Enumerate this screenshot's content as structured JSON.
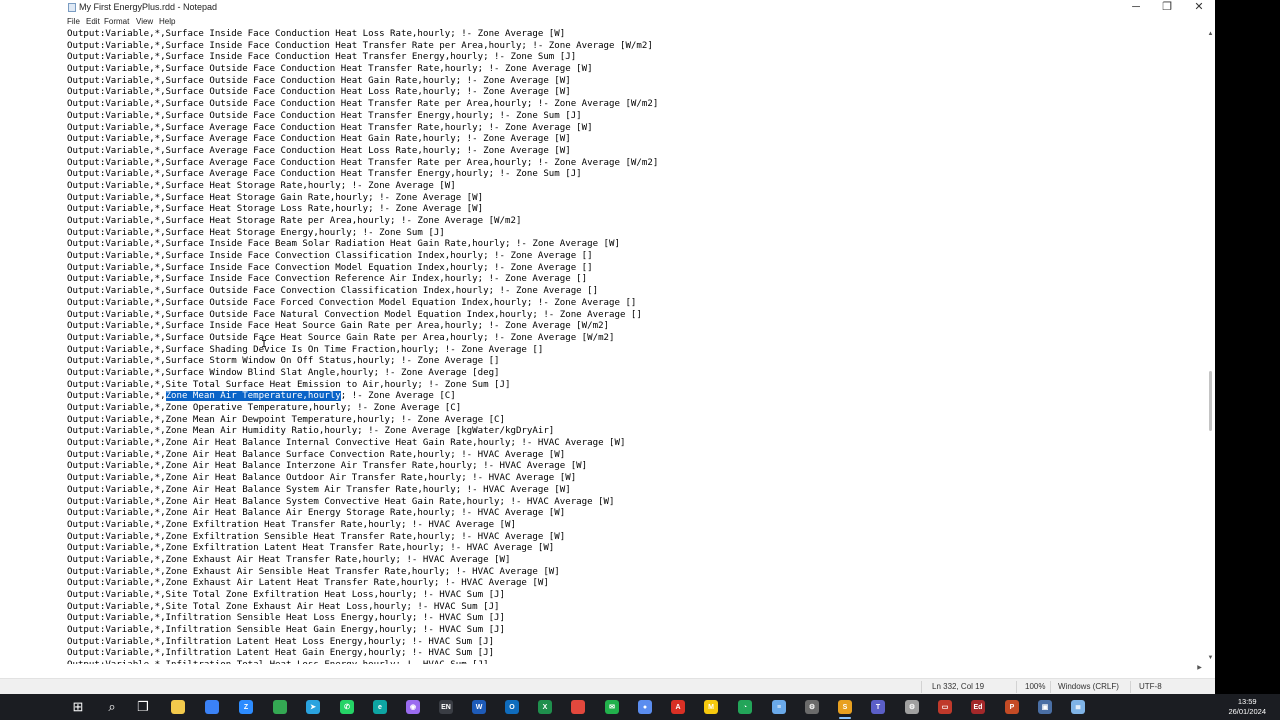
{
  "window": {
    "title": "My First EnergyPlus.rdd - Notepad",
    "controls": {
      "minimize": "─",
      "maximize": "❐",
      "close": "✕"
    }
  },
  "menu": [
    "File",
    "Edit",
    "Format",
    "View",
    "Help"
  ],
  "editor": {
    "selected_line_index": 31,
    "selection": {
      "before": "Output:Variable,*,",
      "selected": "Zone Mean Air Temperature,hourly",
      "after": "; !- Zone Average [C]"
    },
    "lines": [
      "Output:Variable,*,Surface Inside Face Conduction Heat Loss Rate,hourly; !- Zone Average [W]",
      "Output:Variable,*,Surface Inside Face Conduction Heat Transfer Rate per Area,hourly; !- Zone Average [W/m2]",
      "Output:Variable,*,Surface Inside Face Conduction Heat Transfer Energy,hourly; !- Zone Sum [J]",
      "Output:Variable,*,Surface Outside Face Conduction Heat Transfer Rate,hourly; !- Zone Average [W]",
      "Output:Variable,*,Surface Outside Face Conduction Heat Gain Rate,hourly; !- Zone Average [W]",
      "Output:Variable,*,Surface Outside Face Conduction Heat Loss Rate,hourly; !- Zone Average [W]",
      "Output:Variable,*,Surface Outside Face Conduction Heat Transfer Rate per Area,hourly; !- Zone Average [W/m2]",
      "Output:Variable,*,Surface Outside Face Conduction Heat Transfer Energy,hourly; !- Zone Sum [J]",
      "Output:Variable,*,Surface Average Face Conduction Heat Transfer Rate,hourly; !- Zone Average [W]",
      "Output:Variable,*,Surface Average Face Conduction Heat Gain Rate,hourly; !- Zone Average [W]",
      "Output:Variable,*,Surface Average Face Conduction Heat Loss Rate,hourly; !- Zone Average [W]",
      "Output:Variable,*,Surface Average Face Conduction Heat Transfer Rate per Area,hourly; !- Zone Average [W/m2]",
      "Output:Variable,*,Surface Average Face Conduction Heat Transfer Energy,hourly; !- Zone Sum [J]",
      "Output:Variable,*,Surface Heat Storage Rate,hourly; !- Zone Average [W]",
      "Output:Variable,*,Surface Heat Storage Gain Rate,hourly; !- Zone Average [W]",
      "Output:Variable,*,Surface Heat Storage Loss Rate,hourly; !- Zone Average [W]",
      "Output:Variable,*,Surface Heat Storage Rate per Area,hourly; !- Zone Average [W/m2]",
      "Output:Variable,*,Surface Heat Storage Energy,hourly; !- Zone Sum [J]",
      "Output:Variable,*,Surface Inside Face Beam Solar Radiation Heat Gain Rate,hourly; !- Zone Average [W]",
      "Output:Variable,*,Surface Inside Face Convection Classification Index,hourly; !- Zone Average []",
      "Output:Variable,*,Surface Inside Face Convection Model Equation Index,hourly; !- Zone Average []",
      "Output:Variable,*,Surface Inside Face Convection Reference Air Index,hourly; !- Zone Average []",
      "Output:Variable,*,Surface Outside Face Convection Classification Index,hourly; !- Zone Average []",
      "Output:Variable,*,Surface Outside Face Forced Convection Model Equation Index,hourly; !- Zone Average []",
      "Output:Variable,*,Surface Outside Face Natural Convection Model Equation Index,hourly; !- Zone Average []",
      "Output:Variable,*,Surface Inside Face Heat Source Gain Rate per Area,hourly; !- Zone Average [W/m2]",
      "Output:Variable,*,Surface Outside Face Heat Source Gain Rate per Area,hourly; !- Zone Average [W/m2]",
      "Output:Variable,*,Surface Shading Device Is On Time Fraction,hourly; !- Zone Average []",
      "Output:Variable,*,Surface Storm Window On Off Status,hourly; !- Zone Average []",
      "Output:Variable,*,Surface Window Blind Slat Angle,hourly; !- Zone Average [deg]",
      "Output:Variable,*,Site Total Surface Heat Emission to Air,hourly; !- Zone Sum [J]",
      "Output:Variable,*,Zone Mean Air Temperature,hourly; !- Zone Average [C]",
      "Output:Variable,*,Zone Operative Temperature,hourly; !- Zone Average [C]",
      "Output:Variable,*,Zone Mean Air Dewpoint Temperature,hourly; !- Zone Average [C]",
      "Output:Variable,*,Zone Mean Air Humidity Ratio,hourly; !- Zone Average [kgWater/kgDryAir]",
      "Output:Variable,*,Zone Air Heat Balance Internal Convective Heat Gain Rate,hourly; !- HVAC Average [W]",
      "Output:Variable,*,Zone Air Heat Balance Surface Convection Rate,hourly; !- HVAC Average [W]",
      "Output:Variable,*,Zone Air Heat Balance Interzone Air Transfer Rate,hourly; !- HVAC Average [W]",
      "Output:Variable,*,Zone Air Heat Balance Outdoor Air Transfer Rate,hourly; !- HVAC Average [W]",
      "Output:Variable,*,Zone Air Heat Balance System Air Transfer Rate,hourly; !- HVAC Average [W]",
      "Output:Variable,*,Zone Air Heat Balance System Convective Heat Gain Rate,hourly; !- HVAC Average [W]",
      "Output:Variable,*,Zone Air Heat Balance Air Energy Storage Rate,hourly; !- HVAC Average [W]",
      "Output:Variable,*,Zone Exfiltration Heat Transfer Rate,hourly; !- HVAC Average [W]",
      "Output:Variable,*,Zone Exfiltration Sensible Heat Transfer Rate,hourly; !- HVAC Average [W]",
      "Output:Variable,*,Zone Exfiltration Latent Heat Transfer Rate,hourly; !- HVAC Average [W]",
      "Output:Variable,*,Zone Exhaust Air Heat Transfer Rate,hourly; !- HVAC Average [W]",
      "Output:Variable,*,Zone Exhaust Air Sensible Heat Transfer Rate,hourly; !- HVAC Average [W]",
      "Output:Variable,*,Zone Exhaust Air Latent Heat Transfer Rate,hourly; !- HVAC Average [W]",
      "Output:Variable,*,Site Total Zone Exfiltration Heat Loss,hourly; !- HVAC Sum [J]",
      "Output:Variable,*,Site Total Zone Exhaust Air Heat Loss,hourly; !- HVAC Sum [J]",
      "Output:Variable,*,Infiltration Sensible Heat Loss Energy,hourly; !- HVAC Sum [J]",
      "Output:Variable,*,Infiltration Sensible Heat Gain Energy,hourly; !- HVAC Sum [J]",
      "Output:Variable,*,Infiltration Latent Heat Loss Energy,hourly; !- HVAC Sum [J]",
      "Output:Variable,*,Infiltration Latent Heat Gain Energy,hourly; !- HVAC Sum [J]",
      "Output:Variable,*,Infiltration Total Heat Loss Energy,hourly; !- HVAC Sum [J]"
    ]
  },
  "status": {
    "position": "Ln 332, Col 19",
    "zoom": "100%",
    "line_ending": "Windows (CRLF)",
    "encoding": "UTF-8"
  },
  "taskbar": {
    "items": [
      {
        "name": "start-button",
        "glyph": "⊞",
        "color": "#ffffff"
      },
      {
        "name": "search-icon",
        "glyph": "⌕",
        "color": "#ffffff"
      },
      {
        "name": "task-view-icon",
        "glyph": "❐",
        "color": "#ffffff"
      },
      {
        "name": "file-explorer-icon",
        "glyph": "",
        "color": "#f2c94c"
      },
      {
        "name": "store-icon",
        "glyph": "",
        "color": "#3b82f6"
      },
      {
        "name": "zoom-icon",
        "glyph": "Z",
        "color": "#2d8cff"
      },
      {
        "name": "chrome-icon",
        "glyph": "",
        "color": "#34a853"
      },
      {
        "name": "telegram-icon",
        "glyph": "➤",
        "color": "#2aa3df"
      },
      {
        "name": "whatsapp-icon",
        "glyph": "✆",
        "color": "#25d366"
      },
      {
        "name": "edge-icon",
        "glyph": "e",
        "color": "#0ea5a3"
      },
      {
        "name": "github-icon",
        "glyph": "◉",
        "color": "#9b6cf0"
      },
      {
        "name": "language-icon",
        "glyph": "EN",
        "color": "#3a3d44"
      },
      {
        "name": "word-icon",
        "glyph": "W",
        "color": "#1e5bb8"
      },
      {
        "name": "outlook-icon",
        "glyph": "O",
        "color": "#0f6cbd"
      },
      {
        "name": "excel-icon",
        "glyph": "X",
        "color": "#1f8f4d"
      },
      {
        "name": "chrome-alt-icon",
        "glyph": "",
        "color": "#e2483d"
      },
      {
        "name": "chat-icon",
        "glyph": "✉",
        "color": "#22b14c"
      },
      {
        "name": "circle-app-icon",
        "glyph": "●",
        "color": "#5b8def"
      },
      {
        "name": "pdf-icon",
        "glyph": "A",
        "color": "#d93025"
      },
      {
        "name": "miro-icon",
        "glyph": "M",
        "color": "#f6c90e"
      },
      {
        "name": "clock-app-icon",
        "glyph": "◔",
        "color": "#23a559"
      },
      {
        "name": "notepad-icon",
        "glyph": "≡",
        "color": "#6aa9e9"
      },
      {
        "name": "settings-gear-icon",
        "glyph": "⚙",
        "color": "#6b6b6b"
      },
      {
        "name": "sketch-icon",
        "glyph": "S",
        "color": "#e8a020"
      },
      {
        "name": "teams-icon",
        "glyph": "T",
        "color": "#5b5fc7"
      },
      {
        "name": "gear-icon",
        "glyph": "⚙",
        "color": "#a0a0a0"
      },
      {
        "name": "laptop-icon",
        "glyph": "▭",
        "color": "#c0392b"
      },
      {
        "name": "edit-icon",
        "glyph": "Ed",
        "color": "#a3282a"
      },
      {
        "name": "powerpoint-icon",
        "glyph": "P",
        "color": "#c44b25"
      },
      {
        "name": "monitor-icon",
        "glyph": "▣",
        "color": "#4a6fa5"
      },
      {
        "name": "notepad-alt-icon",
        "glyph": "≣",
        "color": "#7fb3e6"
      }
    ],
    "clock_time": "13:59",
    "clock_date": "26/01/2024"
  }
}
